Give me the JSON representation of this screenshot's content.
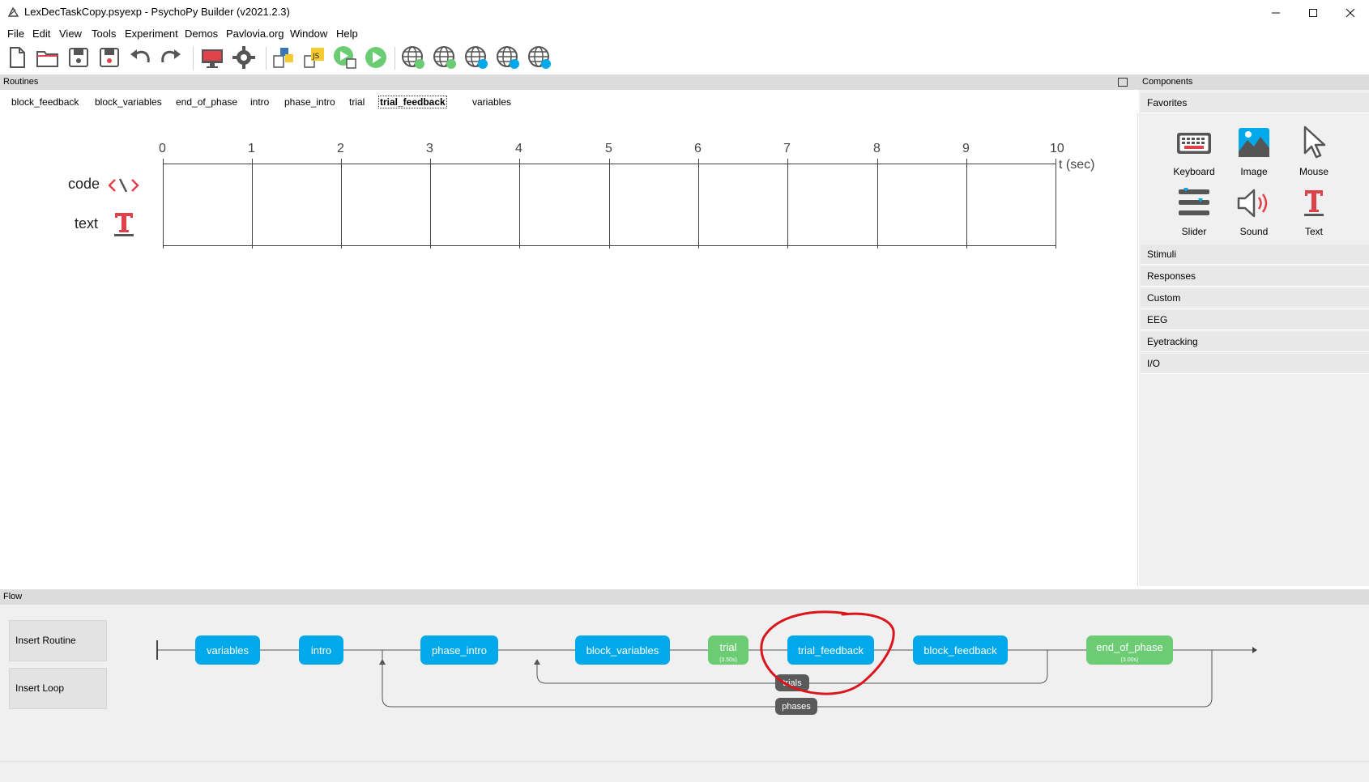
{
  "window": {
    "title": "LexDecTaskCopy.psyexp - PsychoPy Builder (v2021.2.3)",
    "controls": [
      "minimize-icon",
      "maximize-icon",
      "close-icon"
    ]
  },
  "menu": [
    "File",
    "Edit",
    "View",
    "Tools",
    "Experiment",
    "Demos",
    "Pavlovia.org",
    "Window",
    "Help"
  ],
  "toolbar": {
    "icons": [
      "new-file-icon",
      "open-folder-icon",
      "save-icon",
      "save-as-icon",
      "undo-icon",
      "redo-icon",
      "monitor-icon",
      "gear-icon",
      "python-script-icon",
      "js-script-icon",
      "run-python-icon",
      "run-icon",
      "pavlovia-sync-icon",
      "pavlovia-refresh-icon",
      "pavlovia-search-icon",
      "pavlovia-user-icon",
      "pavlovia-info-icon"
    ]
  },
  "routines": {
    "header": "Routines",
    "tabs": [
      "block_feedback",
      "block_variables",
      "end_of_phase",
      "intro",
      "phase_intro",
      "trial",
      "trial_feedback",
      "variables"
    ],
    "active_tab": "trial_feedback",
    "timeline": {
      "ticks": [
        "0",
        "1",
        "2",
        "3",
        "4",
        "5",
        "6",
        "7",
        "8",
        "9",
        "10"
      ],
      "unit_label": "t (sec)",
      "components": [
        {
          "name": "code",
          "icon": "code-icon"
        },
        {
          "name": "text",
          "icon": "text-icon"
        }
      ]
    }
  },
  "components": {
    "header": "Components",
    "favorites_label": "Favorites",
    "favorites": [
      {
        "label": "Keyboard",
        "icon": "keyboard-icon"
      },
      {
        "label": "Image",
        "icon": "image-icon"
      },
      {
        "label": "Mouse",
        "icon": "mouse-icon"
      },
      {
        "label": "Slider",
        "icon": "slider-icon"
      },
      {
        "label": "Sound",
        "icon": "sound-icon"
      },
      {
        "label": "Text",
        "icon": "text-icon"
      }
    ],
    "categories": [
      "Stimuli",
      "Responses",
      "Custom",
      "EEG",
      "Eyetracking",
      "I/O"
    ]
  },
  "flow": {
    "header": "Flow",
    "insert_routine": "Insert Routine",
    "insert_loop": "Insert Loop",
    "routines": [
      {
        "label": "variables",
        "color": "#02a9ea"
      },
      {
        "label": "intro",
        "color": "#02a9ea"
      },
      {
        "label": "phase_intro",
        "color": "#02a9ea"
      },
      {
        "label": "block_variables",
        "color": "#02a9ea"
      },
      {
        "label": "trial",
        "color": "#6ccc74",
        "duration": "(3.50s)"
      },
      {
        "label": "trial_feedback",
        "color": "#02a9ea"
      },
      {
        "label": "block_feedback",
        "color": "#02a9ea"
      },
      {
        "label": "end_of_phase",
        "color": "#6ccc74",
        "duration": "(3.00s)"
      }
    ],
    "loops": [
      "trials",
      "phases"
    ],
    "annotation_color": "#d9161c"
  }
}
